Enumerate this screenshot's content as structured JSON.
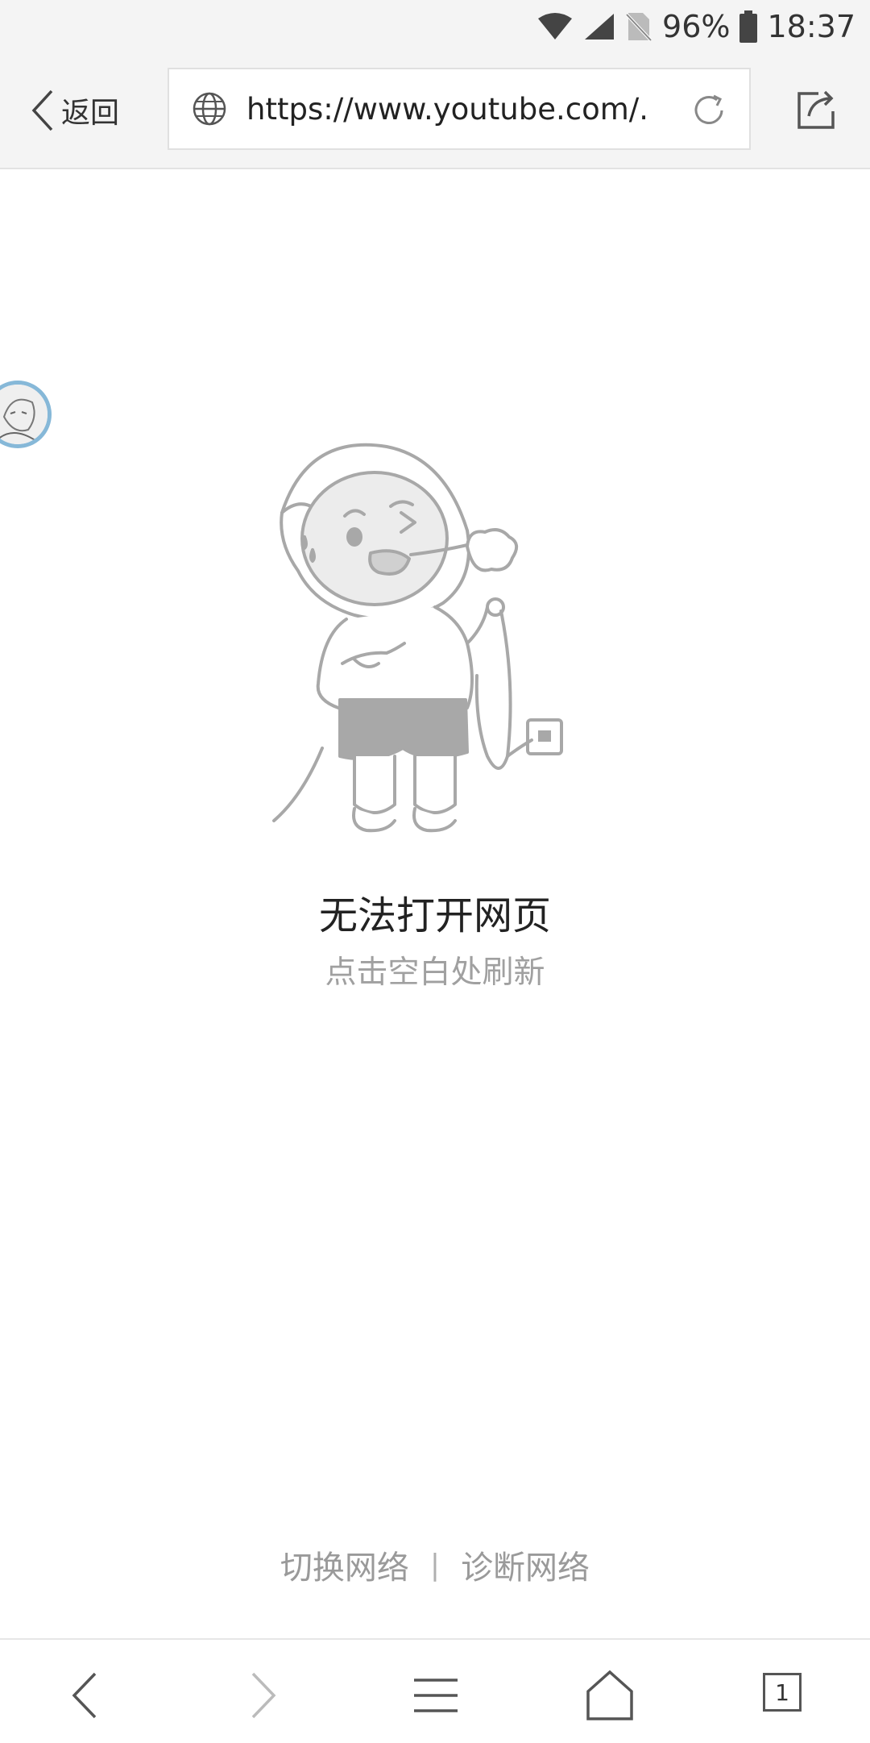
{
  "status_bar": {
    "battery": "96%",
    "time": "18:37"
  },
  "address_bar": {
    "back_label": "返回",
    "url": "https://www.youtube.com/..."
  },
  "error": {
    "title": "无法打开网页",
    "subtitle": "点击空白处刷新"
  },
  "network": {
    "switch_label": "切换网络",
    "separator": "|",
    "diagnose_label": "诊断网络"
  },
  "bottom_nav": {
    "tab_count": "1"
  }
}
